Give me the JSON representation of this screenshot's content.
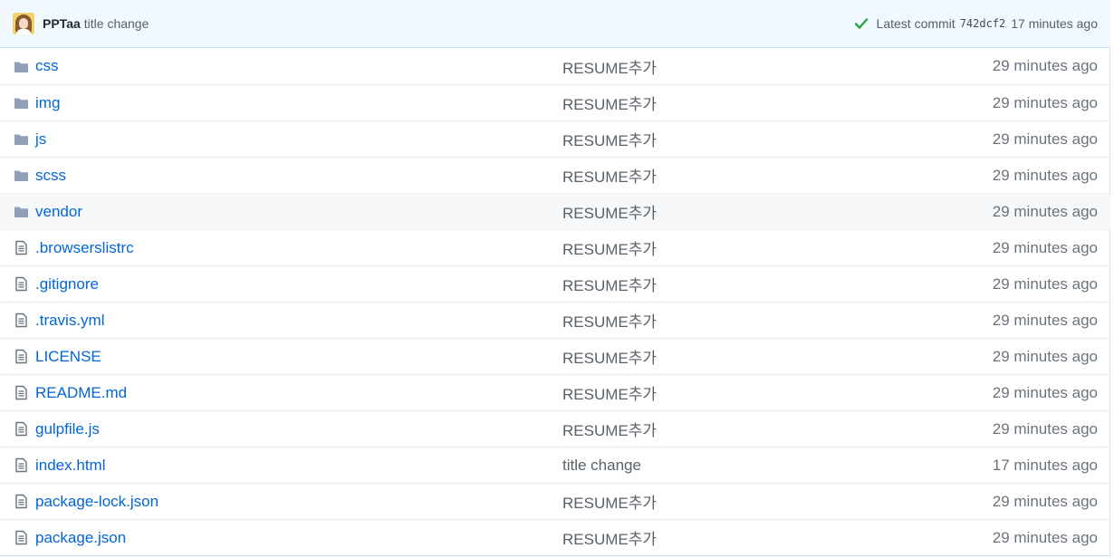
{
  "commit": {
    "author": "PPTaa",
    "message": "title change",
    "latest_label": "Latest commit",
    "sha": "742dcf2",
    "age": "17 minutes ago",
    "status_icon": "check-icon",
    "status_color": "#28a745"
  },
  "colors": {
    "link": "#0366d6",
    "folder_icon": "#79b8ff",
    "file_icon": "#6a737d",
    "header_bg": "#f1f8ff"
  },
  "files": [
    {
      "type": "folder",
      "name": "css",
      "message": "RESUME추가",
      "age": "29 minutes ago"
    },
    {
      "type": "folder",
      "name": "img",
      "message": "RESUME추가",
      "age": "29 minutes ago"
    },
    {
      "type": "folder",
      "name": "js",
      "message": "RESUME추가",
      "age": "29 minutes ago"
    },
    {
      "type": "folder",
      "name": "scss",
      "message": "RESUME추가",
      "age": "29 minutes ago"
    },
    {
      "type": "folder",
      "name": "vendor",
      "message": "RESUME추가",
      "age": "29 minutes ago"
    },
    {
      "type": "file",
      "name": ".browserslistrc",
      "message": "RESUME추가",
      "age": "29 minutes ago"
    },
    {
      "type": "file",
      "name": ".gitignore",
      "message": "RESUME추가",
      "age": "29 minutes ago"
    },
    {
      "type": "file",
      "name": ".travis.yml",
      "message": "RESUME추가",
      "age": "29 minutes ago"
    },
    {
      "type": "file",
      "name": "LICENSE",
      "message": "RESUME추가",
      "age": "29 minutes ago"
    },
    {
      "type": "file",
      "name": "README.md",
      "message": "RESUME추가",
      "age": "29 minutes ago"
    },
    {
      "type": "file",
      "name": "gulpfile.js",
      "message": "RESUME추가",
      "age": "29 minutes ago"
    },
    {
      "type": "file",
      "name": "index.html",
      "message": "title change",
      "age": "17 minutes ago"
    },
    {
      "type": "file",
      "name": "package-lock.json",
      "message": "RESUME추가",
      "age": "29 minutes ago"
    },
    {
      "type": "file",
      "name": "package.json",
      "message": "RESUME추가",
      "age": "29 minutes ago"
    }
  ]
}
